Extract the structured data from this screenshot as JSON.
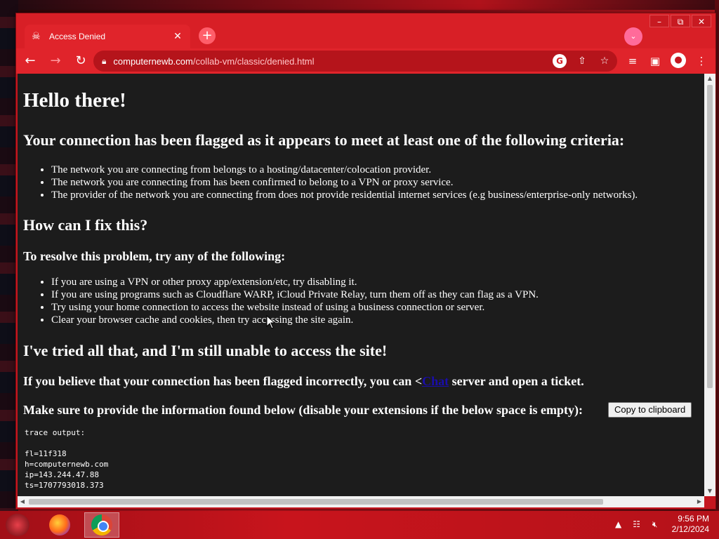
{
  "browser": {
    "tab_title": "Access Denied",
    "new_tab_symbol": "+",
    "url_host": "computernewb.com",
    "url_path": "/collab-vm/classic/denied.html"
  },
  "page": {
    "heading": "Hello there!",
    "flagged_heading": "Your connection has been flagged as it appears to meet at least one of the following criteria:",
    "criteria": [
      "The network you are connecting from belongs to a hosting/datacenter/colocation provider.",
      "The network you are connecting from has been confirmed to belong to a VPN or proxy service.",
      "The provider of the network you are connecting from does not provide residential internet services (e.g business/enterprise-only networks)."
    ],
    "fix_heading": "How can I fix this?",
    "resolve_heading": "To resolve this problem, try any of the following:",
    "fixes": [
      "If you are using a VPN or other proxy app/extension/etc, try disabling it.",
      "If you are using programs such as Cloudflare WARP, iCloud Private Relay, turn them off as they can flag as a VPN.",
      "Try using your home connection to access the website instead of using a business connection or server.",
      "Clear your browser cache and cookies, then try accessing the site again."
    ],
    "tried_heading": "I've tried all that, and I'm still unable to access the site!",
    "ticket_prefix": "If you believe that your connection has been flagged incorrectly, you can <",
    "ticket_link": "Chat",
    "ticket_suffix": " server and open a ticket.",
    "info_text": "Make sure to provide the information found below (disable your extensions if the below space is empty):",
    "copy_button": "Copy to clipboard",
    "trace_label": "trace output:",
    "trace_lines": [
      "fl=11f318",
      "h=computernewb.com",
      "ip=143.244.47.88",
      "ts=1707793018.373"
    ]
  },
  "taskbar": {
    "time": "9:56 PM",
    "date": "2/12/2024"
  },
  "colors": {
    "chrome_theme": "#d81f26",
    "page_bg": "#1c1c1c",
    "link": "#1a0dab"
  }
}
